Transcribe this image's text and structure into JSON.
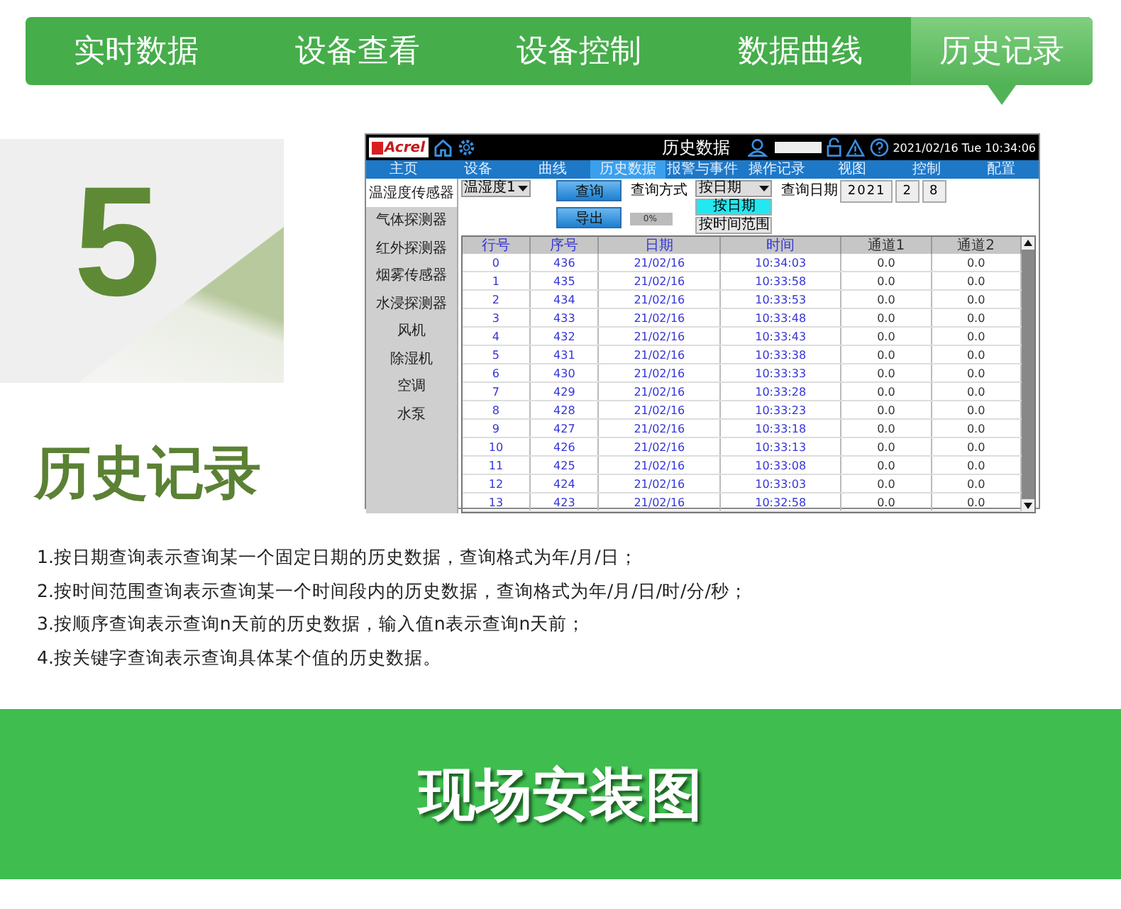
{
  "top_tabs": [
    {
      "label": "实时数据",
      "selected": false
    },
    {
      "label": "设备查看",
      "selected": false
    },
    {
      "label": "设备控制",
      "selected": false
    },
    {
      "label": "数据曲线",
      "selected": false
    },
    {
      "label": "历史记录",
      "selected": true
    }
  ],
  "feature": {
    "number": "5",
    "title": "历史记录"
  },
  "screen": {
    "logo": "Acrel",
    "title": "历史数据",
    "datetime": "2021/02/16 Tue 10:34:06",
    "nav": [
      {
        "label": "主页",
        "selected": false
      },
      {
        "label": "设备",
        "selected": false
      },
      {
        "label": "曲线",
        "selected": false
      },
      {
        "label": "历史数据",
        "selected": true
      },
      {
        "label": "报警与事件",
        "selected": false
      },
      {
        "label": "操作记录",
        "selected": false
      },
      {
        "label": "视图",
        "selected": false
      },
      {
        "label": "控制",
        "selected": false
      },
      {
        "label": "配置",
        "selected": false
      }
    ],
    "sidebar": [
      {
        "label": "温湿度传感器",
        "selected": true
      },
      {
        "label": "气体探测器",
        "selected": false
      },
      {
        "label": "红外探测器",
        "selected": false
      },
      {
        "label": "烟雾传感器",
        "selected": false
      },
      {
        "label": "水浸探测器",
        "selected": false
      },
      {
        "label": "风机",
        "selected": false
      },
      {
        "label": "除湿机",
        "selected": false
      },
      {
        "label": "空调",
        "selected": false
      },
      {
        "label": "水泵",
        "selected": false
      }
    ],
    "sensor_select": "温湿度1",
    "query_button": "查询",
    "export_button": "导出",
    "progress": {
      "level": 0,
      "reading": "0%"
    },
    "query_mode_label": "查询方式",
    "query_mode": "按日期",
    "query_mode_options": [
      {
        "label": "按日期",
        "selected": true
      },
      {
        "label": "按时间范围",
        "selected": false
      }
    ],
    "date_label": "查询日期",
    "date_fields": [
      "2021",
      "2",
      "8"
    ],
    "table": {
      "columns": [
        "行号",
        "序号",
        "日期",
        "时间",
        "通道1",
        "通道2"
      ],
      "rows": [
        [
          "0",
          "436",
          "21/02/16",
          "10:34:03",
          "0.0",
          "0.0"
        ],
        [
          "1",
          "435",
          "21/02/16",
          "10:33:58",
          "0.0",
          "0.0"
        ],
        [
          "2",
          "434",
          "21/02/16",
          "10:33:53",
          "0.0",
          "0.0"
        ],
        [
          "3",
          "433",
          "21/02/16",
          "10:33:48",
          "0.0",
          "0.0"
        ],
        [
          "4",
          "432",
          "21/02/16",
          "10:33:43",
          "0.0",
          "0.0"
        ],
        [
          "5",
          "431",
          "21/02/16",
          "10:33:38",
          "0.0",
          "0.0"
        ],
        [
          "6",
          "430",
          "21/02/16",
          "10:33:33",
          "0.0",
          "0.0"
        ],
        [
          "7",
          "429",
          "21/02/16",
          "10:33:28",
          "0.0",
          "0.0"
        ],
        [
          "8",
          "428",
          "21/02/16",
          "10:33:23",
          "0.0",
          "0.0"
        ],
        [
          "9",
          "427",
          "21/02/16",
          "10:33:18",
          "0.0",
          "0.0"
        ],
        [
          "10",
          "426",
          "21/02/16",
          "10:33:13",
          "0.0",
          "0.0"
        ],
        [
          "11",
          "425",
          "21/02/16",
          "10:33:08",
          "0.0",
          "0.0"
        ],
        [
          "12",
          "424",
          "21/02/16",
          "10:33:03",
          "0.0",
          "0.0"
        ],
        [
          "13",
          "423",
          "21/02/16",
          "10:32:58",
          "0.0",
          "0.0"
        ]
      ]
    }
  },
  "notes": [
    "1.按日期查询表示查询某一个固定日期的历史数据，查询格式为年/月/日；",
    "2.按时间范围查询表示查询某一个时间段内的历史数据，查询格式为年/月/日/时/分/秒；",
    "3.按顺序查询表示查询n天前的历史数据，输入值n表示查询n天前；",
    "4.按关键字查询表示查询具体某个值的历史数据。"
  ],
  "banner": {
    "title": "现场安装图"
  }
}
